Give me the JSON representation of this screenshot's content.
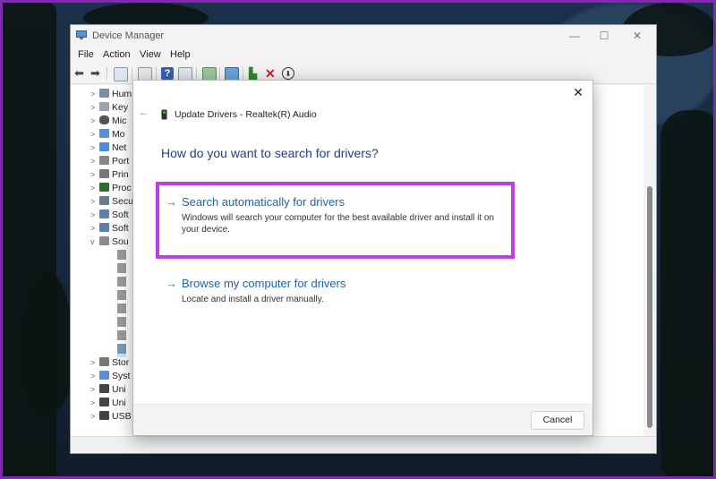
{
  "window": {
    "title": "Device Manager",
    "controls": {
      "minimize": "—",
      "maximize": "☐",
      "close": "✕"
    }
  },
  "menu": [
    "File",
    "Action",
    "View",
    "Help"
  ],
  "tree": {
    "categories": [
      "Hum",
      "Key",
      "Mic",
      "Mo",
      "Net",
      "Port",
      "Prin",
      "Proc",
      "Secu",
      "Soft",
      "Soft",
      "Sou"
    ],
    "bottom_categories": [
      "Stor",
      "Syst",
      "Uni",
      "Uni",
      "USB"
    ]
  },
  "dialog": {
    "title": "Update Drivers - Realtek(R) Audio",
    "question": "How do you want to search for drivers?",
    "options": [
      {
        "arrow": "→",
        "title": "Search automatically for drivers",
        "description": "Windows will search your computer for the best available driver and install it on your device."
      },
      {
        "arrow": "→",
        "title": "Browse my computer for drivers",
        "description": "Locate and install a driver manually."
      }
    ],
    "back": "←",
    "close": "✕",
    "cancel_label": "Cancel"
  },
  "colors": {
    "highlight": "#c13ee0",
    "link": "#1a64b0",
    "question": "#1f3f8a",
    "frame": "#7a2fa8"
  }
}
